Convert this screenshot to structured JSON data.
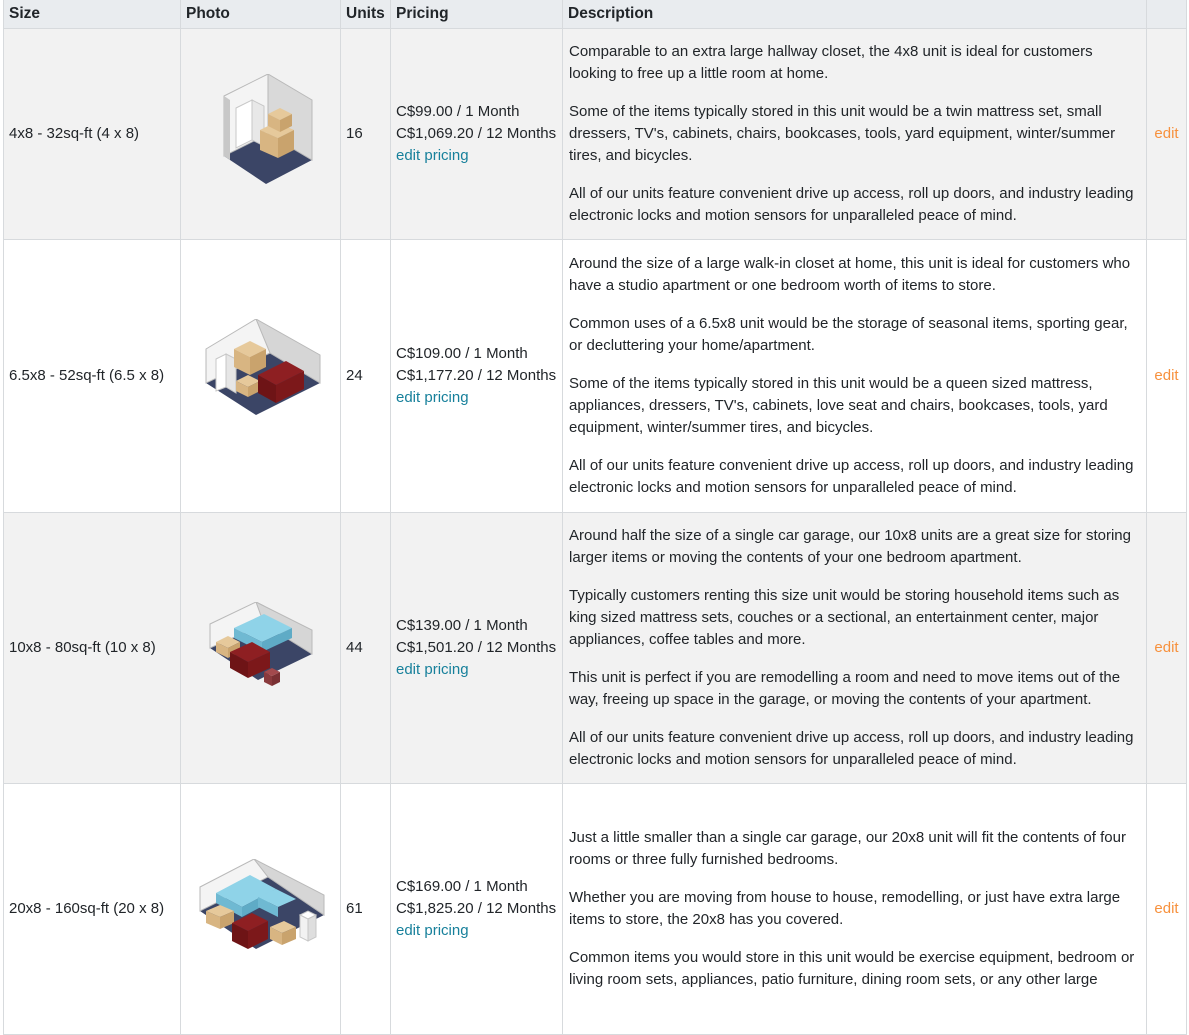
{
  "headers": {
    "size": "Size",
    "photo": "Photo",
    "units": "Units",
    "pricing": "Pricing",
    "description": "Description",
    "actions": ""
  },
  "links": {
    "edit_pricing": "edit pricing",
    "edit": "edit"
  },
  "colors": {
    "link": "#17809b",
    "edit": "#f7913d",
    "header_bg": "#e9ecef",
    "stripe_bg": "#f2f2f2"
  },
  "rows": [
    {
      "size": "4x8 - 32sq-ft (4 x 8)",
      "photo_icon": "storage-unit-4x8-image",
      "units": "16",
      "price_monthly": "C$99.00 / 1 Month",
      "price_yearly": "C$1,069.20 / 12 Months",
      "description": [
        "Comparable to an extra large hallway closet, the 4x8 unit is ideal for customers looking to free up a little room at home.",
        "Some of the items typically stored in this unit would be a twin mattress set, small dressers, TV's, cabinets, chairs, bookcases, tools, yard equipment, winter/summer tires, and bicycles.",
        "All of our units feature convenient drive up access, roll up doors, and industry leading electronic locks and motion sensors for unparalleled peace of mind."
      ]
    },
    {
      "size": "6.5x8 - 52sq-ft (6.5 x 8)",
      "photo_icon": "storage-unit-6-5x8-image",
      "units": "24",
      "price_monthly": "C$109.00 / 1 Month",
      "price_yearly": "C$1,177.20 / 12 Months",
      "description": [
        "Around the size of a large walk-in closet at home, this unit is ideal for customers who have a studio apartment or one bedroom worth of items to store.",
        "Common uses of a 6.5x8 unit would be the storage of seasonal items, sporting gear, or decluttering your home/apartment.",
        "Some of the items typically stored in this unit would be a queen sized mattress, appliances, dressers, TV's, cabinets, love seat and chairs, bookcases, tools, yard equipment, winter/summer tires, and bicycles.",
        "All of our units feature convenient drive up access, roll up doors, and industry leading electronic locks and motion sensors for unparalleled peace of mind."
      ]
    },
    {
      "size": "10x8 - 80sq-ft (10 x 8)",
      "photo_icon": "storage-unit-10x8-image",
      "units": "44",
      "price_monthly": "C$139.00 / 1 Month",
      "price_yearly": "C$1,501.20 / 12 Months",
      "description": [
        "Around half the size of a single car garage, our 10x8 units are a great size for storing larger items or moving the contents of your one bedroom apartment.",
        "Typically customers renting this size unit would be storing household items such as king sized mattress sets, couches or a sectional, an entertainment center, major appliances, coffee tables and more.",
        "This unit is perfect if you are remodelling a room and need to move items out of the way, freeing up space in the garage, or moving the contents of your apartment.",
        "All of our units feature convenient drive up access, roll up doors, and industry leading electronic locks and motion sensors for unparalleled peace of mind."
      ]
    },
    {
      "size": "20x8 - 160sq-ft (20 x 8)",
      "photo_icon": "storage-unit-20x8-image",
      "units": "61",
      "price_monthly": "C$169.00 / 1 Month",
      "price_yearly": "C$1,825.20 / 12 Months",
      "description": [
        "Just a little smaller than a single car garage, our 20x8 unit will fit the contents of four rooms or three fully furnished bedrooms.",
        "Whether you are moving from house to house, remodelling, or just have extra large items to store, the 20x8 has you covered.",
        "Common items you would store in this unit would be exercise equipment, bedroom or living room sets, appliances, patio furniture, dining room sets, or any other large"
      ]
    }
  ]
}
